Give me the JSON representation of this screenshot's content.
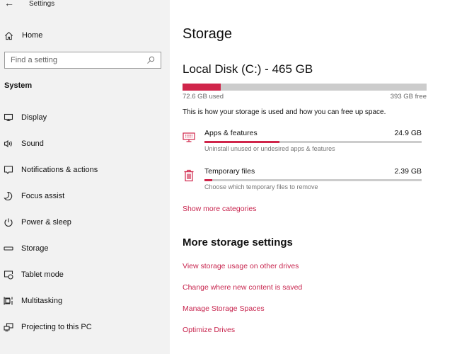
{
  "window": {
    "title": "Settings",
    "back_icon": "back-arrow-icon"
  },
  "sidebar": {
    "home_label": "Home",
    "search_placeholder": "Find a setting",
    "section_label": "System",
    "items": [
      {
        "label": "Display",
        "icon": "display-icon"
      },
      {
        "label": "Sound",
        "icon": "sound-icon"
      },
      {
        "label": "Notifications & actions",
        "icon": "notifications-icon"
      },
      {
        "label": "Focus assist",
        "icon": "moon-icon"
      },
      {
        "label": "Power & sleep",
        "icon": "power-icon"
      },
      {
        "label": "Storage",
        "icon": "storage-icon"
      },
      {
        "label": "Tablet mode",
        "icon": "tablet-mode-icon"
      },
      {
        "label": "Multitasking",
        "icon": "multitasking-icon"
      },
      {
        "label": "Projecting to this PC",
        "icon": "projecting-icon"
      }
    ]
  },
  "main": {
    "page_title": "Storage",
    "disk": {
      "title": "Local Disk (C:) - 465 GB",
      "used_label": "72.6 GB used",
      "free_label": "393 GB free",
      "used_fraction": 0.156,
      "description": "This is how your storage is used and how you can free up space."
    },
    "categories": [
      {
        "name": "Apps & features",
        "size": "24.9 GB",
        "description": "Uninstall unused or undesired apps & features",
        "fraction": 0.345,
        "icon": "apps-features-icon"
      },
      {
        "name": "Temporary files",
        "size": "2.39 GB",
        "description": "Choose which temporary files to remove",
        "fraction": 0.035,
        "icon": "trash-icon"
      }
    ],
    "show_more_label": "Show more categories",
    "more_settings": {
      "heading": "More storage settings",
      "links": [
        "View storage usage on other drives",
        "Change where new content is saved",
        "Manage Storage Spaces",
        "Optimize Drives"
      ]
    }
  },
  "colors": {
    "accent": "#d0254a",
    "link": "#c8264f",
    "bar_track": "#cccccc",
    "sidebar_bg": "#f2f2f2"
  }
}
